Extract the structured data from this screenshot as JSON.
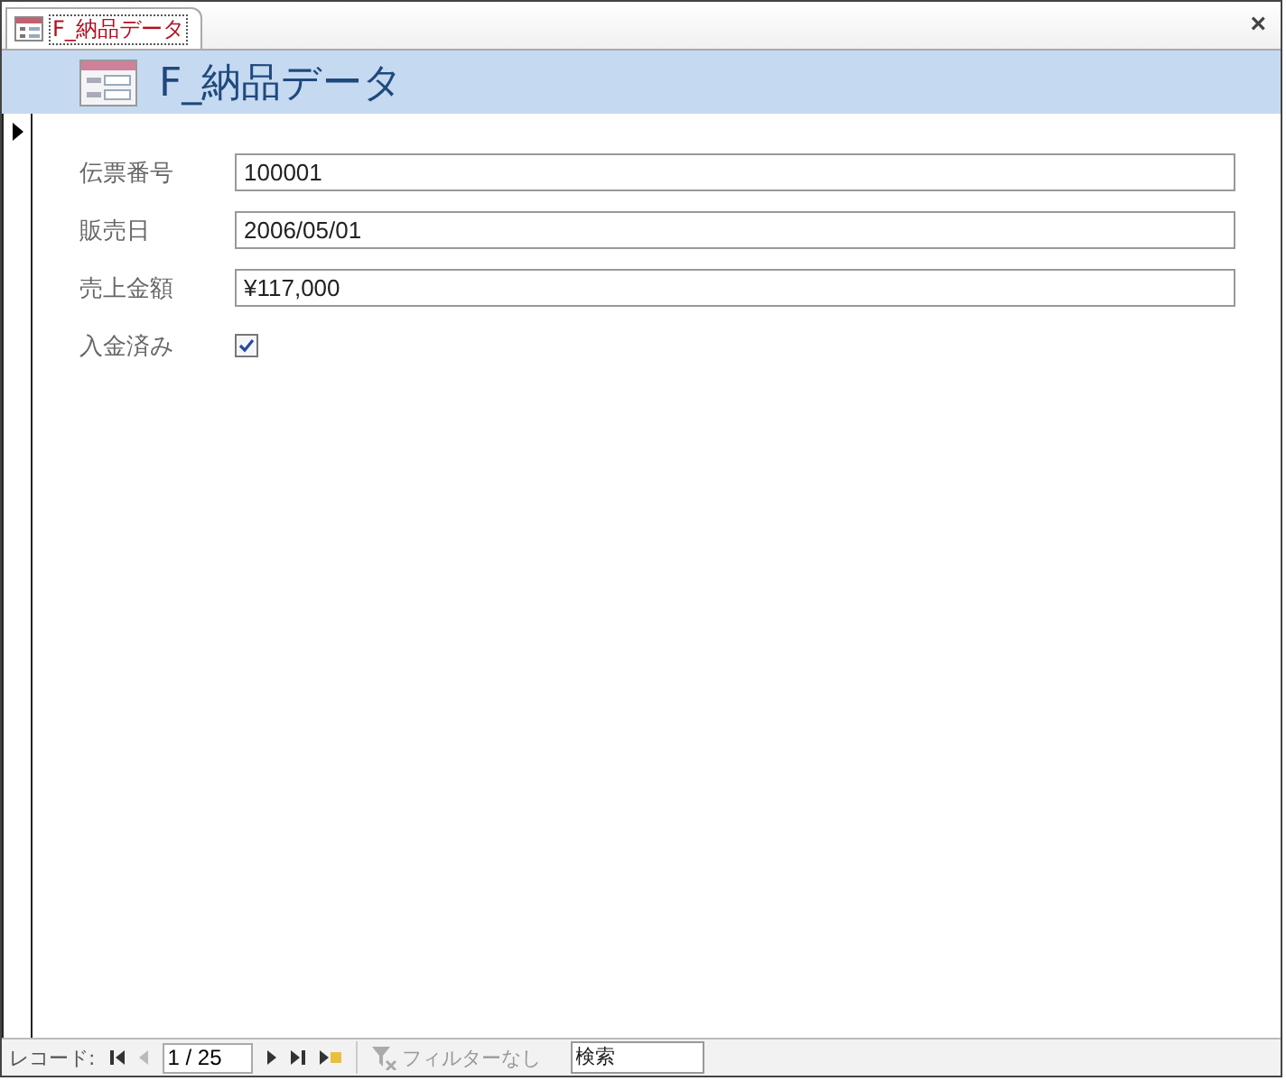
{
  "tab": {
    "title": "F_納品データ",
    "selected": true,
    "close": "×"
  },
  "header": {
    "title": "F_納品データ"
  },
  "fields": [
    {
      "kind": "text",
      "label": "伝票番号",
      "value": "100001"
    },
    {
      "kind": "text",
      "label": "販売日",
      "value": "2006/05/01"
    },
    {
      "kind": "text",
      "label": "売上金額",
      "value": "¥117,000"
    },
    {
      "kind": "checkbox",
      "label": "入金済み",
      "checked": true
    }
  ],
  "navigation": {
    "label": "レコード:",
    "position": "1 / 25",
    "filter": {
      "label": "フィルターなし",
      "disabled": true
    },
    "search": {
      "placeholder": "検索"
    }
  }
}
